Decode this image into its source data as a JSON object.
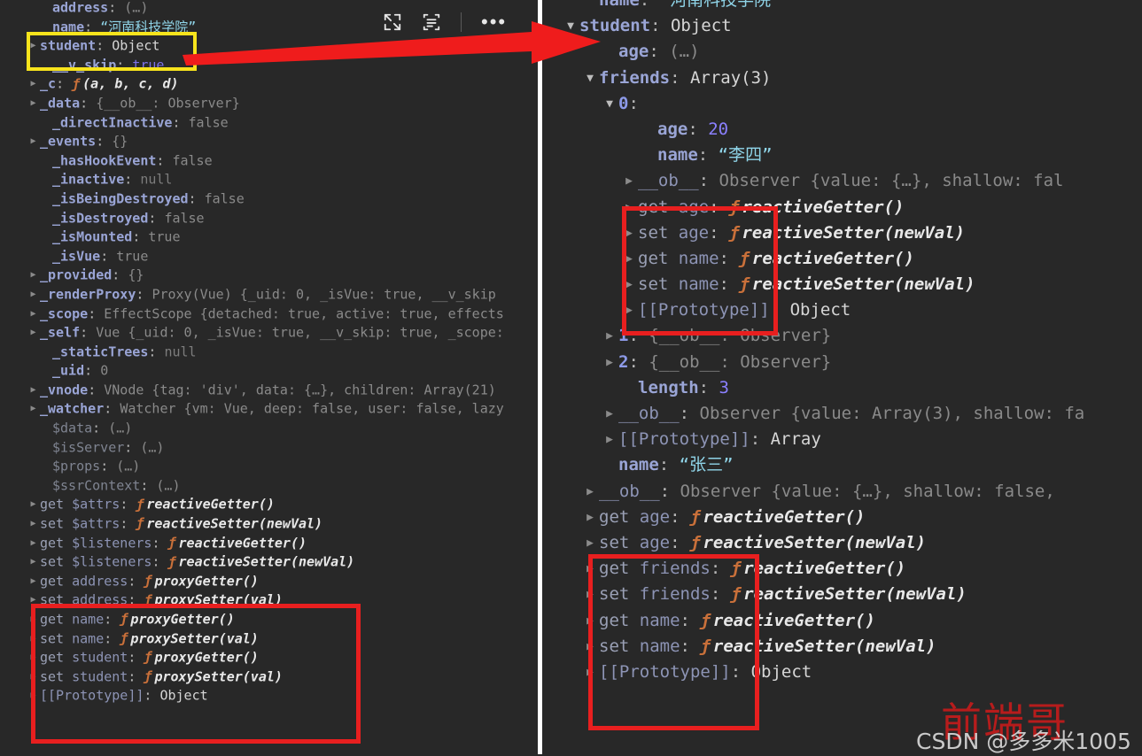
{
  "app": {
    "name": "chrome-devtools-console-object-inspector",
    "background": "#282828",
    "divider_color": "#ffffff"
  },
  "toolbar": {
    "icons": [
      {
        "name": "popout-icon",
        "label": "Open in new panel"
      },
      {
        "name": "wrap-text-icon",
        "label": "Wrap text"
      },
      {
        "name": "more-options-icon",
        "label": "..."
      }
    ],
    "dots": "•••"
  },
  "annotations": {
    "yellow_box_label": "student: Object",
    "arrow_color": "#ef1c1c",
    "red_box_color": "#e81f1f",
    "yellow_box_color": "#f7e41c"
  },
  "watermark": {
    "cn": "前端哥",
    "csdn": "CSDN @多多米1005"
  },
  "left_panel": {
    "name": "vue-instance-expanded",
    "rows": [
      {
        "tw": "blank",
        "indent": 2,
        "key": "address",
        "kc": "key",
        "sep": ": ",
        "val": "(…)",
        "vc": "val-dim"
      },
      {
        "tw": "blank",
        "indent": 2,
        "key": "name",
        "kc": "key",
        "sep": ": ",
        "val": "“河南科技学院”",
        "vc": "val-str"
      },
      {
        "tw": "closed",
        "indent": 1,
        "key": "student",
        "kc": "key",
        "sep": ": ",
        "val": "Object",
        "vc": "val-obj"
      },
      {
        "tw": "blank",
        "indent": 2,
        "key": "__v_skip",
        "kc": "key",
        "sep": ": ",
        "val": "true",
        "vc": "val-bool"
      },
      {
        "tw": "closed",
        "indent": 1,
        "key": "_c",
        "kc": "key",
        "sep": ": ",
        "fn": "ƒ",
        "fname": "(a, b, c, d)"
      },
      {
        "tw": "closed",
        "indent": 1,
        "key": "_data",
        "kc": "key",
        "sep": ": ",
        "preview": "{__ob__: Observer}"
      },
      {
        "tw": "blank",
        "indent": 2,
        "key": "_directInactive",
        "kc": "key",
        "sep": ": ",
        "val": "false",
        "vc": "val-dim"
      },
      {
        "tw": "closed",
        "indent": 1,
        "key": "_events",
        "kc": "key",
        "sep": ": ",
        "val": "{}",
        "vc": "val-dim"
      },
      {
        "tw": "blank",
        "indent": 2,
        "key": "_hasHookEvent",
        "kc": "key",
        "sep": ": ",
        "val": "false",
        "vc": "val-dim"
      },
      {
        "tw": "blank",
        "indent": 2,
        "key": "_inactive",
        "kc": "key",
        "sep": ": ",
        "val": "null",
        "vc": "val-null"
      },
      {
        "tw": "blank",
        "indent": 2,
        "key": "_isBeingDestroyed",
        "kc": "key",
        "sep": ": ",
        "val": "false",
        "vc": "val-dim"
      },
      {
        "tw": "blank",
        "indent": 2,
        "key": "_isDestroyed",
        "kc": "key",
        "sep": ": ",
        "val": "false",
        "vc": "val-dim"
      },
      {
        "tw": "blank",
        "indent": 2,
        "key": "_isMounted",
        "kc": "key",
        "sep": ": ",
        "val": "true",
        "vc": "val-dim"
      },
      {
        "tw": "blank",
        "indent": 2,
        "key": "_isVue",
        "kc": "key",
        "sep": ": ",
        "val": "true",
        "vc": "val-dim"
      },
      {
        "tw": "closed",
        "indent": 1,
        "key": "_provided",
        "kc": "key",
        "sep": ": ",
        "val": "{}",
        "vc": "val-dim"
      },
      {
        "tw": "closed",
        "indent": 1,
        "key": "_renderProxy",
        "kc": "key",
        "sep": ": ",
        "val": "Proxy(Vue)",
        "vc": "val-dim",
        "preview": "{_uid: 0, _isVue: true, __v_skip"
      },
      {
        "tw": "closed",
        "indent": 1,
        "key": "_scope",
        "kc": "key",
        "sep": ": ",
        "val": "EffectScope",
        "vc": "val-dim",
        "preview": "{detached: true, active: true, effects"
      },
      {
        "tw": "closed",
        "indent": 1,
        "key": "_self",
        "kc": "key",
        "sep": ": ",
        "val": "Vue",
        "vc": "val-dim",
        "preview": "{_uid: 0, _isVue: true, __v_skip: true, _scope:"
      },
      {
        "tw": "blank",
        "indent": 2,
        "key": "_staticTrees",
        "kc": "key",
        "sep": ": ",
        "val": "null",
        "vc": "val-null"
      },
      {
        "tw": "blank",
        "indent": 2,
        "key": "_uid",
        "kc": "key",
        "sep": ": ",
        "val": "0",
        "vc": "val-dim"
      },
      {
        "tw": "closed",
        "indent": 1,
        "key": "_vnode",
        "kc": "key",
        "sep": ": ",
        "val": "VNode",
        "vc": "val-dim",
        "preview": "{tag: 'div', data: {…}, children: Array(21)"
      },
      {
        "tw": "closed",
        "indent": 1,
        "key": "_watcher",
        "kc": "key",
        "sep": ": ",
        "val": "Watcher",
        "vc": "val-dim",
        "preview": "{vm: Vue, deep: false, user: false, lazy"
      },
      {
        "tw": "blank",
        "indent": 2,
        "key": "$data",
        "kc": "key-dim",
        "sep": ": ",
        "val": "(…)",
        "vc": "val-dim"
      },
      {
        "tw": "blank",
        "indent": 2,
        "key": "$isServer",
        "kc": "key-dim",
        "sep": ": ",
        "val": "(…)",
        "vc": "val-dim"
      },
      {
        "tw": "blank",
        "indent": 2,
        "key": "$props",
        "kc": "key-dim",
        "sep": ": ",
        "val": "(…)",
        "vc": "val-dim"
      },
      {
        "tw": "blank",
        "indent": 2,
        "key": "$ssrContext",
        "kc": "key-dim",
        "sep": ": ",
        "val": "(…)",
        "vc": "val-dim"
      },
      {
        "tw": "closed",
        "indent": 1,
        "acc": "get",
        "key": "$attrs",
        "kc": "key-proto",
        "sep": ": ",
        "fn": "ƒ",
        "fname": "reactiveGetter()"
      },
      {
        "tw": "closed",
        "indent": 1,
        "acc": "set",
        "key": "$attrs",
        "kc": "key-proto",
        "sep": ": ",
        "fn": "ƒ",
        "fname": "reactiveSetter(newVal)"
      },
      {
        "tw": "closed",
        "indent": 1,
        "acc": "get",
        "key": "$listeners",
        "kc": "key-proto",
        "sep": ": ",
        "fn": "ƒ",
        "fname": "reactiveGetter()"
      },
      {
        "tw": "closed",
        "indent": 1,
        "acc": "set",
        "key": "$listeners",
        "kc": "key-proto",
        "sep": ": ",
        "fn": "ƒ",
        "fname": "reactiveSetter(newVal)"
      },
      {
        "tw": "closed",
        "indent": 1,
        "acc": "get",
        "key": "address",
        "kc": "key-proto",
        "sep": ": ",
        "fn": "ƒ",
        "fname": "proxyGetter()"
      },
      {
        "tw": "closed",
        "indent": 1,
        "acc": "set",
        "key": "address",
        "kc": "key-proto",
        "sep": ": ",
        "fn": "ƒ",
        "fname": "proxySetter(val)"
      },
      {
        "tw": "closed",
        "indent": 1,
        "acc": "get",
        "key": "name",
        "kc": "key-proto",
        "sep": ": ",
        "fn": "ƒ",
        "fname": "proxyGetter()"
      },
      {
        "tw": "closed",
        "indent": 1,
        "acc": "set",
        "key": "name",
        "kc": "key-proto",
        "sep": ": ",
        "fn": "ƒ",
        "fname": "proxySetter(val)"
      },
      {
        "tw": "closed",
        "indent": 1,
        "acc": "get",
        "key": "student",
        "kc": "key-proto",
        "sep": ": ",
        "fn": "ƒ",
        "fname": "proxyGetter()"
      },
      {
        "tw": "closed",
        "indent": 1,
        "acc": "set",
        "key": "student",
        "kc": "key-proto",
        "sep": ": ",
        "fn": "ƒ",
        "fname": "proxySetter(val)"
      },
      {
        "tw": "closed",
        "indent": 1,
        "key": "[[Prototype]]",
        "kc": "key-proto",
        "sep": ": ",
        "val": "Object",
        "vc": "val-obj"
      }
    ]
  },
  "right_panel": {
    "name": "student-object-expanded",
    "rows": [
      {
        "tw": "blank",
        "indent": 1,
        "key": "name",
        "kc": "key",
        "sep": ": ",
        "val": "“河南科技学院”",
        "vc": "val-str"
      },
      {
        "tw": "open",
        "indent": 0,
        "key": "student",
        "kc": "key",
        "sep": ": ",
        "val": "Object",
        "vc": "val-obj"
      },
      {
        "tw": "blank",
        "indent": 2,
        "key": "age",
        "kc": "key",
        "sep": ": ",
        "val": "(…)",
        "vc": "val-dim"
      },
      {
        "tw": "open",
        "indent": 1,
        "key": "friends",
        "kc": "key",
        "sep": ": ",
        "val": "Array(3)",
        "vc": "val-obj"
      },
      {
        "tw": "open",
        "indent": 2,
        "key": "0",
        "kc": "key-idx",
        "sep": ":",
        "val": "",
        "vc": "val-obj"
      },
      {
        "tw": "blank",
        "indent": 4,
        "key": "age",
        "kc": "key",
        "sep": ": ",
        "val": "20",
        "vc": "val-num"
      },
      {
        "tw": "blank",
        "indent": 4,
        "key": "name",
        "kc": "key",
        "sep": ": ",
        "val": "“李四”",
        "vc": "val-str"
      },
      {
        "tw": "closed",
        "indent": 3,
        "key": "__ob__",
        "kc": "key-proto",
        "sep": ": ",
        "val": "Observer",
        "vc": "val-dim",
        "preview": "{value: {…}, shallow: fal"
      },
      {
        "tw": "closed",
        "indent": 3,
        "acc": "get",
        "key": "age",
        "kc": "key-proto",
        "sep": ": ",
        "fn": "ƒ",
        "fname": "reactiveGetter()"
      },
      {
        "tw": "closed",
        "indent": 3,
        "acc": "set",
        "key": "age",
        "kc": "key-proto",
        "sep": ": ",
        "fn": "ƒ",
        "fname": "reactiveSetter(newVal)"
      },
      {
        "tw": "closed",
        "indent": 3,
        "acc": "get",
        "key": "name",
        "kc": "key-proto",
        "sep": ": ",
        "fn": "ƒ",
        "fname": "reactiveGetter()"
      },
      {
        "tw": "closed",
        "indent": 3,
        "acc": "set",
        "key": "name",
        "kc": "key-proto",
        "sep": ": ",
        "fn": "ƒ",
        "fname": "reactiveSetter(newVal)"
      },
      {
        "tw": "closed",
        "indent": 3,
        "key": "[[Prototype]]",
        "kc": "key-proto",
        "sep": ": ",
        "val": "Object",
        "vc": "val-obj"
      },
      {
        "tw": "closed",
        "indent": 2,
        "key": "1",
        "kc": "key-idx",
        "sep": ": ",
        "preview": "{__ob__: Observer}"
      },
      {
        "tw": "closed",
        "indent": 2,
        "key": "2",
        "kc": "key-idx",
        "sep": ": ",
        "preview": "{__ob__: Observer}"
      },
      {
        "tw": "blank",
        "indent": 3,
        "key": "length",
        "kc": "key",
        "sep": ": ",
        "val": "3",
        "vc": "val-num"
      },
      {
        "tw": "closed",
        "indent": 2,
        "key": "__ob__",
        "kc": "key-proto",
        "sep": ": ",
        "val": "Observer",
        "vc": "val-dim",
        "preview": "{value: Array(3), shallow: fa"
      },
      {
        "tw": "closed",
        "indent": 2,
        "key": "[[Prototype]]",
        "kc": "key-proto",
        "sep": ": ",
        "val": "Array",
        "vc": "val-obj"
      },
      {
        "tw": "blank",
        "indent": 2,
        "key": "name",
        "kc": "key",
        "sep": ": ",
        "val": "“张三”",
        "vc": "val-str"
      },
      {
        "tw": "closed",
        "indent": 1,
        "key": "__ob__",
        "kc": "key-proto",
        "sep": ": ",
        "val": "Observer",
        "vc": "val-dim",
        "preview": "{value: {…}, shallow: false, "
      },
      {
        "tw": "closed",
        "indent": 1,
        "acc": "get",
        "key": "age",
        "kc": "key-proto",
        "sep": ": ",
        "fn": "ƒ",
        "fname": "reactiveGetter()"
      },
      {
        "tw": "closed",
        "indent": 1,
        "acc": "set",
        "key": "age",
        "kc": "key-proto",
        "sep": ": ",
        "fn": "ƒ",
        "fname": "reactiveSetter(newVal)"
      },
      {
        "tw": "closed",
        "indent": 1,
        "acc": "get",
        "key": "friends",
        "kc": "key-proto",
        "sep": ": ",
        "fn": "ƒ",
        "fname": "reactiveGetter()"
      },
      {
        "tw": "closed",
        "indent": 1,
        "acc": "set",
        "key": "friends",
        "kc": "key-proto",
        "sep": ": ",
        "fn": "ƒ",
        "fname": "reactiveSetter(newVal)"
      },
      {
        "tw": "closed",
        "indent": 1,
        "acc": "get",
        "key": "name",
        "kc": "key-proto",
        "sep": ": ",
        "fn": "ƒ",
        "fname": "reactiveGetter()"
      },
      {
        "tw": "closed",
        "indent": 1,
        "acc": "set",
        "key": "name",
        "kc": "key-proto",
        "sep": ": ",
        "fn": "ƒ",
        "fname": "reactiveSetter(newVal)"
      },
      {
        "tw": "closed",
        "indent": 1,
        "key": "[[Prototype]]",
        "kc": "key-proto",
        "sep": ": ",
        "val": "Object",
        "vc": "val-obj"
      }
    ]
  }
}
